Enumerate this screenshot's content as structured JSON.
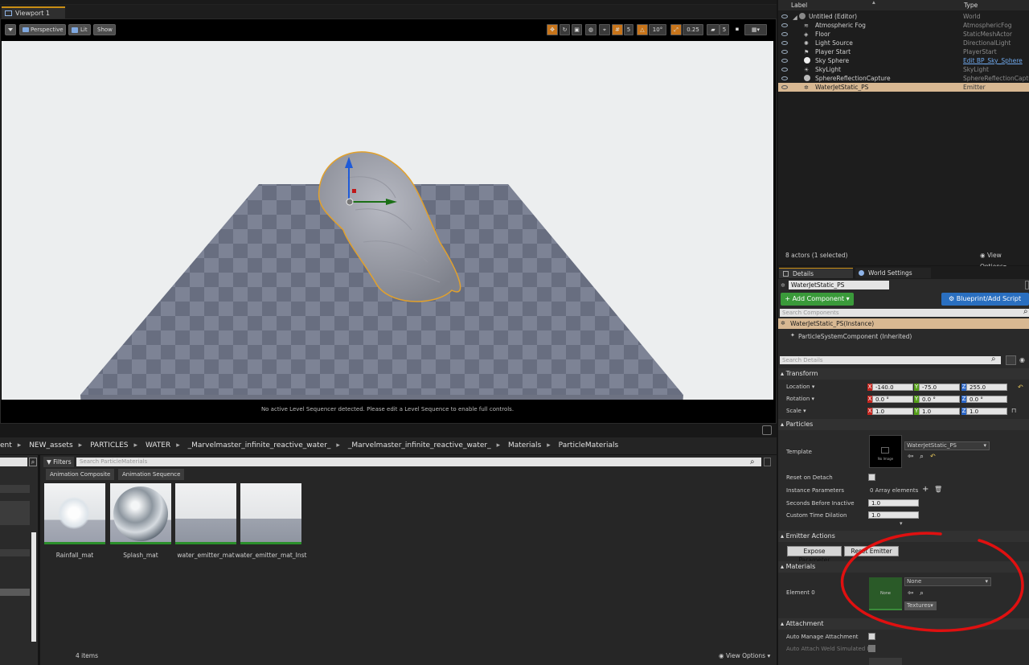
{
  "viewport": {
    "tab_label": "Viewport 1",
    "perspective_label": "Perspective",
    "lit_label": "Lit",
    "show_label": "Show",
    "snap_grid": "5",
    "snap_angle": "10°",
    "snap_scale": "0.25",
    "camera_speed": "5",
    "status_message": "No active Level Sequencer detected. Please edit a Level Sequence to enable full controls."
  },
  "content_browser": {
    "path": [
      "ent",
      "NEW_assets",
      "PARTICLES",
      "WATER",
      "_Marvelmaster_infinite_reactive_water_",
      "_Marvelmaster_infinite_reactive_water_",
      "Materials",
      "ParticleMaterials"
    ],
    "filters_label": "Filters",
    "search_placeholder": "Search ParticleMaterials",
    "filter_chips": [
      "Animation Composite",
      "Animation Sequence"
    ],
    "assets": [
      {
        "name": "Rainfall_mat"
      },
      {
        "name": "Splash_mat"
      },
      {
        "name": "water_emitter_mat"
      },
      {
        "name": "water_emitter_mat_Inst"
      }
    ],
    "item_count": "4 items",
    "view_options": "View Options"
  },
  "outliner": {
    "col_label": "Label",
    "col_type": "Type",
    "rows": [
      {
        "label": "Untitled (Editor)",
        "type": "World"
      },
      {
        "label": "Atmospheric Fog",
        "type": "AtmosphericFog"
      },
      {
        "label": "Floor",
        "type": "StaticMeshActor"
      },
      {
        "label": "Light Source",
        "type": "DirectionalLight"
      },
      {
        "label": "Player Start",
        "type": "PlayerStart"
      },
      {
        "label": "Sky Sphere",
        "type": "Edit BP_Sky_Sphere"
      },
      {
        "label": "SkyLight",
        "type": "SkyLight"
      },
      {
        "label": "SphereReflectionCapture",
        "type": "SphereReflectionCapture"
      },
      {
        "label": "WaterJetStatic_PS",
        "type": "Emitter"
      }
    ],
    "actor_count": "8 actors (1 selected)",
    "view_options": "View Options"
  },
  "details": {
    "tab_details": "Details",
    "tab_world": "World Settings",
    "name_value": "WaterJetStatic_PS",
    "add_component": "+ Add Component",
    "blueprint_button": "Blueprint/Add Script",
    "search_components": "Search Components",
    "instance_label": "WaterJetStatic_PS(Instance)",
    "component_label": "ParticleSystemComponent (Inherited)",
    "search_details": "Search Details",
    "transform": {
      "header": "Transform",
      "location_label": "Location",
      "rotation_label": "Rotation",
      "scale_label": "Scale",
      "location": [
        "-140.0",
        "-75.0",
        "255.0"
      ],
      "rotation": [
        "0.0 °",
        "0.0 °",
        "0.0 °"
      ],
      "scale": [
        "1.0",
        "1.0",
        "1.0"
      ]
    },
    "particles": {
      "header": "Particles",
      "template_label": "Template",
      "template_value": "WaterJetStatic_PS",
      "no_image": "No Image",
      "reset_on_detach": "Reset on Detach",
      "instance_params": "Instance Parameters",
      "instance_params_value": "0 Array elements",
      "seconds_before_inactive": "Seconds Before Inactive",
      "seconds_value": "1.0",
      "custom_time_dilation": "Custom Time Dilation",
      "dilation_value": "1.0"
    },
    "emitter_actions": {
      "header": "Emitter Actions",
      "expose_param": "Expose Parameter",
      "reset_emitter": "Reset Emitter"
    },
    "materials": {
      "header": "Materials",
      "element_label": "Element 0",
      "thumb_label": "None",
      "dropdown_value": "None",
      "textures_label": "Textures"
    },
    "attachment": {
      "header": "Attachment",
      "auto_manage": "Auto Manage Attachment",
      "auto_attach_weld": "Auto Attach Weld Simulated Bo"
    }
  },
  "colors": {
    "selection_accent": "#c98e14",
    "add_component_green": "#3a9a3a",
    "blueprint_blue": "#2a6fc0",
    "annotation_red": "#e01010"
  }
}
